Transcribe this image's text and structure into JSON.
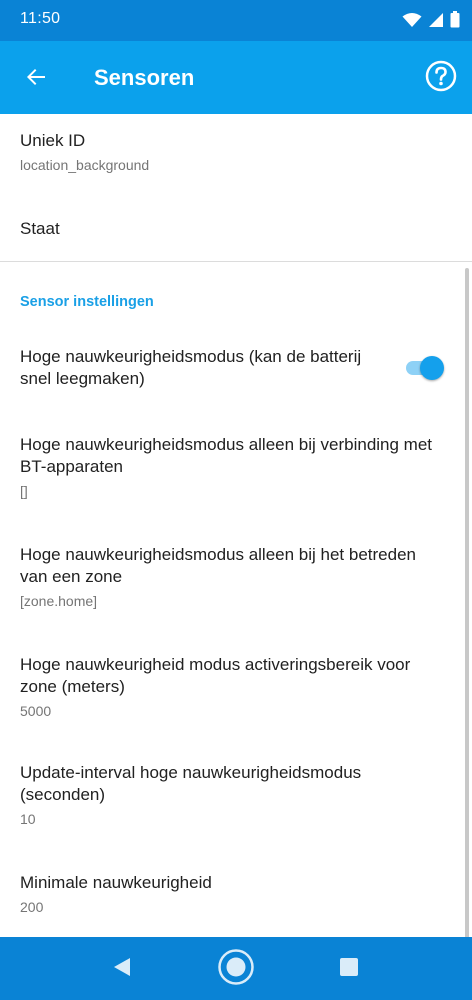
{
  "status_bar": {
    "time": "11:50"
  },
  "app_bar": {
    "title": "Sensoren"
  },
  "items": [
    {
      "title": "Uniek ID",
      "value": "location_background"
    },
    {
      "title": "Staat"
    }
  ],
  "section": {
    "header": "Sensor instellingen"
  },
  "settings": [
    {
      "title": "Hoge nauwkeurigheidsmodus (kan de batterij snel leegmaken)",
      "toggle_on": true
    },
    {
      "title": "Hoge nauwkeurigheidsmodus alleen bij verbinding met BT-apparaten",
      "value": "[]"
    },
    {
      "title": "Hoge nauwkeurigheidsmodus alleen bij het betreden van een zone",
      "value": "[zone.home]"
    },
    {
      "title": "Hoge nauwkeurigheid modus activeringsbereik voor zone (meters)",
      "value": "5000"
    },
    {
      "title": "Update-interval hoge nauwkeurigheidsmodus (seconden)",
      "value": "10"
    },
    {
      "title": "Minimale nauwkeurigheid",
      "value": "200"
    }
  ],
  "colors": {
    "status_bar": "#0a83d5",
    "app_bar": "#0ba1ec",
    "accent": "#1aa0e6"
  }
}
